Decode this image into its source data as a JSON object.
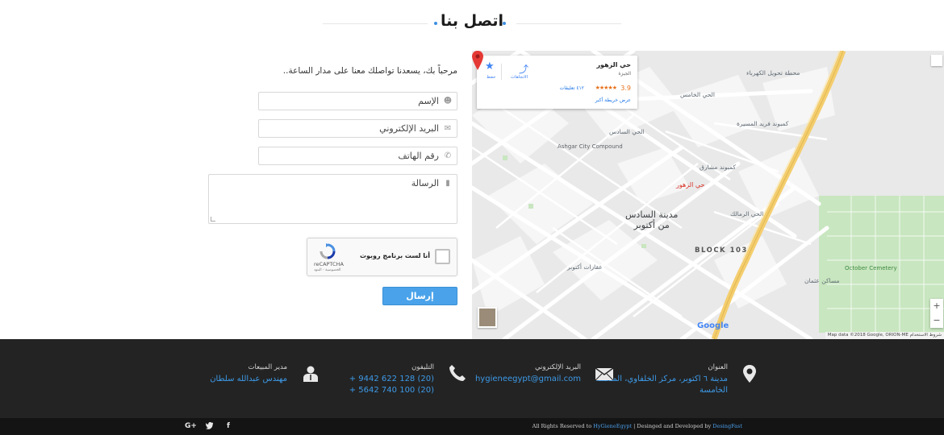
{
  "section_title": "اتصل بنا",
  "form": {
    "intro": "مرحباً بك، يسعدنا تواصلك معنا على مدار الساعة..",
    "name_placeholder": "الإسم",
    "email_placeholder": "البريد الإلكتروني",
    "phone_placeholder": "رقم الهاتف",
    "message_placeholder": "الرسالة",
    "captcha_label": "أنا لست برنامج روبوت",
    "captcha_brand": "reCAPTCHA",
    "captcha_terms": "الخصوصية - البنود",
    "submit_label": "إرسال"
  },
  "map": {
    "place_name": "حي الزهور",
    "place_sub": "الجيزة",
    "rating": "3.9",
    "stars": "★★★★★",
    "reviews": "٤١٢ تعليقات",
    "larger_map": "عرض خريطة أكبر",
    "directions": "الاتجاهات",
    "save": "حفظ",
    "pin_label": "حي الزهور",
    "city_line1": "مدينة السادس",
    "city_line2": "من أكتوبر",
    "block": "BLOCK 103",
    "compound": "Ashgar City Compound",
    "cemetery": "October Cemetery",
    "labels": {
      "l1": "الحي الخامس",
      "l2": "الحي السادس",
      "l3": "محطة تحويل الكهرباء",
      "l4": "كمبوند فريد المسيرة",
      "l5": "كمبوند مشارق",
      "l6": "الحي الرمالك",
      "l7": "عقارات أكتوبر",
      "l8": "مساكن عثمان",
      "l9": "الحي الخامس"
    },
    "google": "Google",
    "attribution": "Map data ©2018 Google, ORION-ME   شروط الاستخدام"
  },
  "footer": {
    "address_label": "العنوان",
    "address_value": "مدينة ٦ اكتوبر، مركز الخلفاوي، المنطقة الخامسة",
    "email_label": "البريد الإلكتروني",
    "email_value": "hygieneegypt@gmail.com",
    "phone_label": "التليفون",
    "phone_1": "+ 9442 622 128 (20)",
    "phone_2": "+ 5642 740 100 (20)",
    "manager_label": "مدير المبيعات",
    "manager_value": "مهندس عبدالله سلطان"
  },
  "bottom": {
    "text_1": "All Rights Reserved to",
    "brand": "HyGieneEgypt",
    "text_2": "| Desinged and Developed by",
    "dev": "DesingFast",
    "social": {
      "google": "G+",
      "twitter": "t",
      "facebook": "f"
    }
  },
  "colors": {
    "accent": "#4aa3ea",
    "footer": "#232323",
    "link": "#3d9ae8"
  }
}
